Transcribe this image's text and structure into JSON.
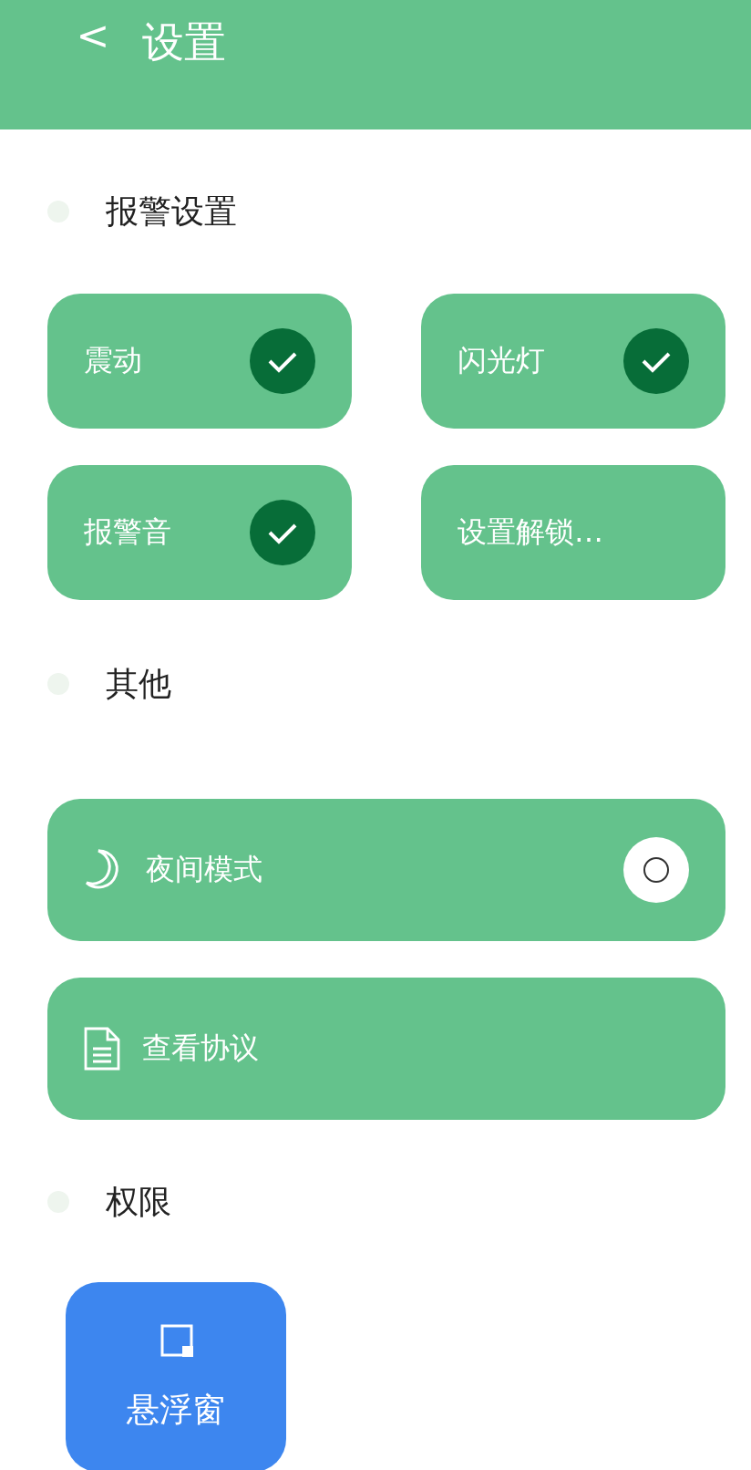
{
  "header": {
    "back": "<",
    "title": "设置"
  },
  "alarm_section": {
    "title": "报警设置",
    "tiles": [
      {
        "label": "震动",
        "kind": "toggle",
        "checked": true
      },
      {
        "label": "闪光灯",
        "kind": "toggle",
        "checked": true
      },
      {
        "label": "报警音",
        "kind": "toggle",
        "checked": true
      },
      {
        "label": "设置解锁…",
        "kind": "link"
      }
    ]
  },
  "other_section": {
    "title": "其他",
    "rows": [
      {
        "label": "夜间模式",
        "kind": "switch",
        "on": false
      },
      {
        "label": "查看协议",
        "kind": "link"
      }
    ]
  },
  "permission_section": {
    "title": "权限",
    "tiles": [
      {
        "label": "悬浮窗"
      }
    ]
  }
}
